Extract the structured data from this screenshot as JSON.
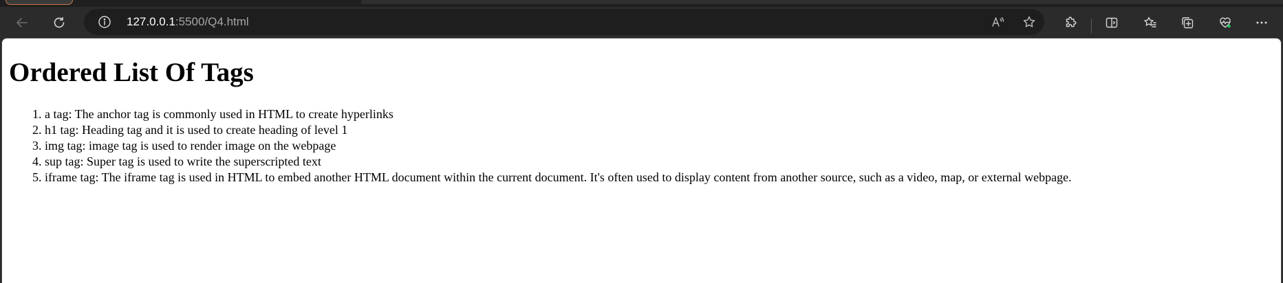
{
  "browser": {
    "address": {
      "host": "127.0.0.1",
      "path": ":5500/Q4.html"
    },
    "icons": {
      "back": "back-arrow-icon",
      "refresh": "refresh-icon",
      "info": "info-icon",
      "read_aloud": "read-aloud-icon",
      "favorite": "star-icon",
      "extensions": "puzzle-icon",
      "split_screen": "split-screen-icon",
      "favorites": "favorites-list-icon",
      "collections": "collections-icon",
      "performance": "heart-pulse-icon",
      "more": "more-dots-icon"
    },
    "colors": {
      "chrome_bg": "#2b2b2b",
      "address_bg": "#1e1e1e",
      "performance_badge": "#22c55e"
    }
  },
  "page": {
    "title": "Ordered List Of Tags",
    "items": [
      "a tag: The anchor tag is commonly used in HTML to create hyperlinks",
      "h1 tag: Heading tag and it is used to create heading of level 1",
      "img tag: image tag is used to render image on the webpage",
      "sup tag: Super tag is used to write the superscripted text",
      "iframe tag: The iframe tag is used in HTML to embed another HTML document within the current document. It's often used to display content from another source, such as a video, map, or external webpage."
    ]
  }
}
